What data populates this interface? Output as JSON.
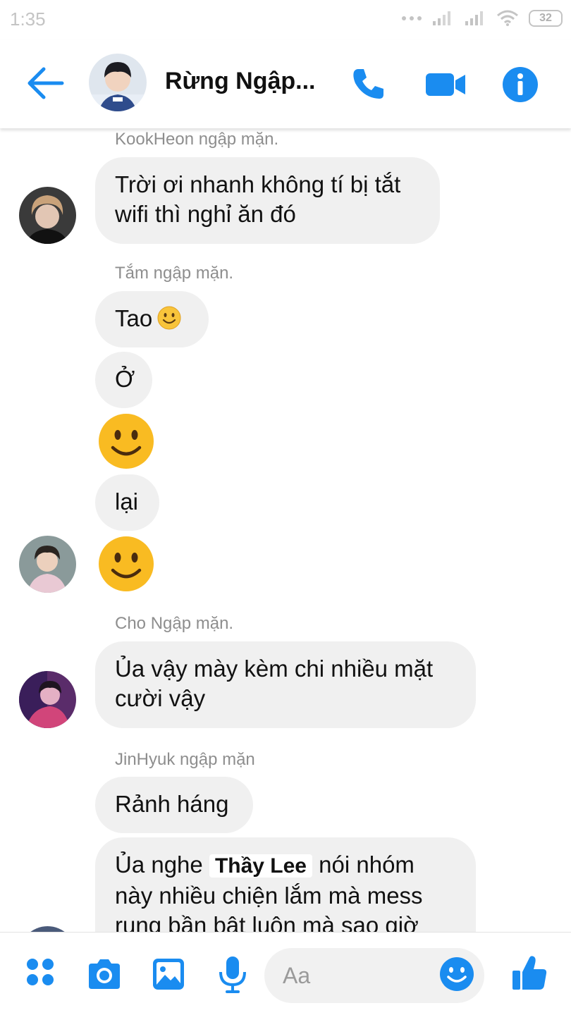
{
  "status": {
    "time": "1:35",
    "battery": "32"
  },
  "header": {
    "title": "Rừng Ngập...",
    "icons": [
      "back-arrow-icon",
      "phone-icon",
      "video-camera-icon",
      "info-icon"
    ]
  },
  "messages": [
    {
      "sender": "KookHeon ngập mặn.",
      "bubbles": [
        "Trời ơi nhanh không tí bị tắt\nwifi thì nghỉ ăn đó"
      ]
    },
    {
      "sender": "Tắm ngập mặn.",
      "bubbles": [
        "Tao",
        "Ở",
        "lại"
      ],
      "emojis": [
        "smiley-face-emoji",
        "smiley-face-emoji",
        "smiley-face-emoji"
      ]
    },
    {
      "sender": "Cho Ngập mặn.",
      "bubbles": [
        "Ủa vậy mày kèm chi nhiều mặt\ncười vậy"
      ]
    },
    {
      "sender": "JinHyuk ngập mặn",
      "bubbles": [
        "Rảnh háng"
      ]
    }
  ],
  "last_message": {
    "before": "Ủa nghe",
    "highlight": "Thầy Lee",
    "after": "nói nhóm",
    "line2": "này nhiều chiện lắm mà mess",
    "line3": "rung bần bật luộn mà sao giờ"
  },
  "composer": {
    "placeholder": "Aa",
    "icons": [
      "apps-icon",
      "camera-icon",
      "gallery-icon",
      "microphone-icon",
      "emoji-icon",
      "like-icon"
    ]
  },
  "colors": {
    "accent": "#1a8cf0",
    "bubble": "#f0f0f0",
    "muted": "#8e8e8e"
  }
}
